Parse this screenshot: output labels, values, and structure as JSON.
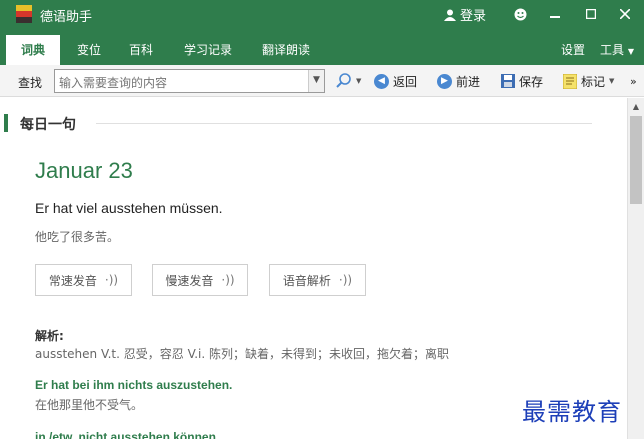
{
  "window": {
    "title": "德语助手",
    "login_label": "登录"
  },
  "tabs": [
    "词典",
    "变位",
    "百科",
    "学习记录",
    "翻译朗读"
  ],
  "menu": {
    "settings": "设置",
    "tools": "工具"
  },
  "search": {
    "label": "查找",
    "placeholder": "输入需要查询的内容",
    "back": "返回",
    "forward": "前进",
    "save": "保存",
    "mark": "标记"
  },
  "daily": {
    "section_title": "每日一句",
    "date": "Januar 23",
    "sentence": "Er hat viel ausstehen müssen.",
    "translation": "他吃了很多苦。",
    "buttons": [
      "常速发音",
      "慢速发音",
      "语音解析"
    ],
    "parse_heading": "解析:",
    "parse_text": "ausstehen V.t. 忍受，容忍 V.i. 陈列；缺着，未得到；未收回，拖欠着；离职",
    "example1_de": "Er hat bei ihm nichts auszustehen.",
    "example1_cn": "在他那里他不受气。",
    "example2_de": "jn./etw. nicht ausstehen können"
  },
  "watermark": "最需教育",
  "colors": {
    "brand": "#2f7d4c",
    "accent": "#4a88d1"
  }
}
